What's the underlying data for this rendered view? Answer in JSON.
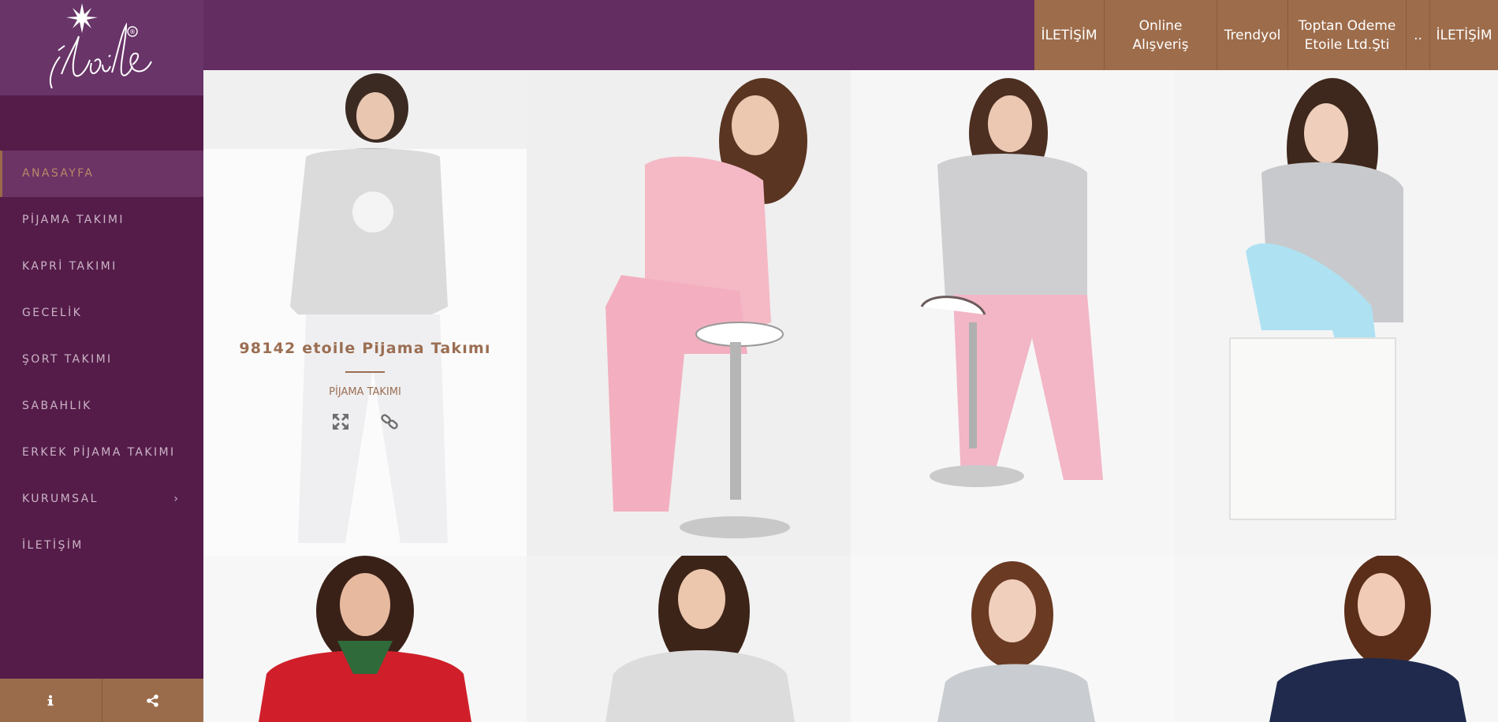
{
  "brand": {
    "logo_text": "étoile",
    "registered_mark": "®"
  },
  "sidebar": {
    "items": [
      {
        "label": "ANASAYFA",
        "active": true
      },
      {
        "label": "PİJAMA TAKIMI"
      },
      {
        "label": "KAPRİ TAKIMI"
      },
      {
        "label": "GECELİK"
      },
      {
        "label": "ŞORT TAKIMI"
      },
      {
        "label": "SABAHLIK"
      },
      {
        "label": "ERKEK PİJAMA TAKIMI"
      },
      {
        "label": "KURUMSAL",
        "has_submenu": true
      },
      {
        "label": "İLETİŞİM"
      }
    ],
    "footer": [
      {
        "icon": "info-icon"
      },
      {
        "icon": "share-icon"
      }
    ]
  },
  "topnav": {
    "items": [
      {
        "label": "İLETİŞİM"
      },
      {
        "label": "Online Alışveriş"
      },
      {
        "label": "Trendyol"
      },
      {
        "label": "Toptan Odeme Etoile Ltd.Şti"
      },
      {
        "label": ".."
      },
      {
        "label": "İLETİŞİM"
      }
    ]
  },
  "products": {
    "hovered": {
      "title": "98142 etoile Pijama Takımı",
      "category": "PİJAMA TAKIMI",
      "icons": [
        "expand-icon",
        "link-icon"
      ]
    }
  },
  "colors": {
    "sidebar": "#551c49",
    "logo_bg": "#693468",
    "topbar": "#632d61",
    "accent": "#9d6c4b"
  }
}
